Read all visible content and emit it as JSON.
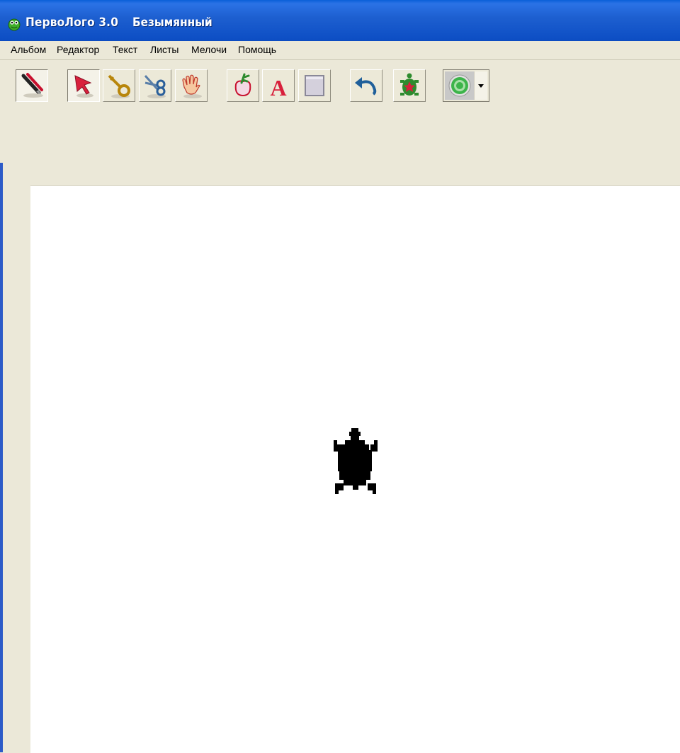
{
  "window": {
    "app_title": "ПервоЛого 3.0",
    "document_title": "Безымянный",
    "icon": "frog-logo-icon"
  },
  "menu": {
    "items": [
      {
        "label": "Альбом"
      },
      {
        "label": "Редактор"
      },
      {
        "label": "Текст"
      },
      {
        "label": "Листы"
      },
      {
        "label": "Мелочи"
      },
      {
        "label": "Помощь"
      }
    ]
  },
  "toolbar": {
    "buttons": [
      {
        "icon": "pen-brush-icon",
        "state": "pressed"
      },
      {
        "icon": "arrow-pointer-icon",
        "state": "pressed"
      },
      {
        "icon": "key-icon",
        "state": "normal"
      },
      {
        "icon": "scissors-icon",
        "state": "normal"
      },
      {
        "icon": "hand-icon",
        "state": "normal"
      },
      {
        "icon": "new-turtle-icon",
        "state": "normal"
      },
      {
        "icon": "text-tool-icon",
        "state": "normal"
      },
      {
        "icon": "box-tool-icon",
        "state": "normal"
      },
      {
        "icon": "undo-icon",
        "state": "normal"
      },
      {
        "icon": "turtle-star-icon",
        "state": "normal"
      },
      {
        "icon": "color-target-icon",
        "state": "normal"
      }
    ],
    "colors": {
      "accent_red": "#d8203c",
      "turtle_green": "#2e8b2e",
      "target_green": "#3cb44a"
    }
  },
  "canvas": {
    "background": "#ffffff",
    "turtle_icon": "turtle-icon",
    "turtle_color": "#000000"
  }
}
